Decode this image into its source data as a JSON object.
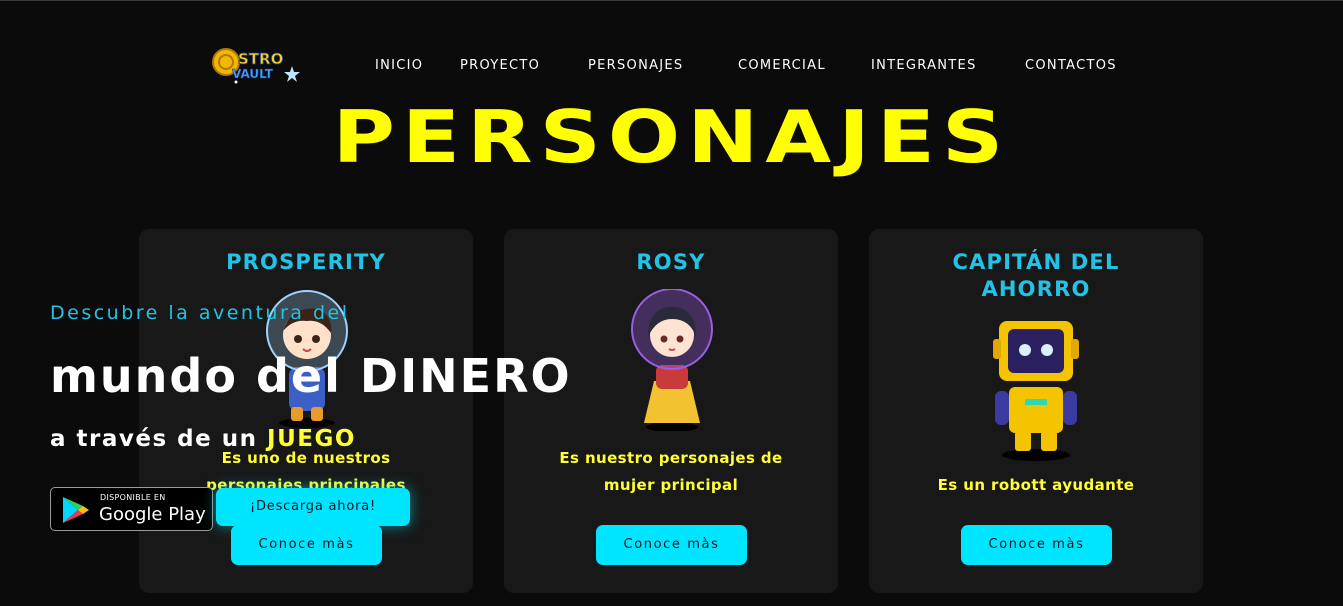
{
  "logo": {
    "text_top": "STRO",
    "text_bottom": "VAULT"
  },
  "nav": [
    "INICIO",
    "PROYECTO",
    "PERSONAJES",
    "COMERCIAL",
    "INTEGRANTES",
    "CONTACTOS"
  ],
  "page_title": "PERSONAJES",
  "cards": [
    {
      "title": "PROSPERITY",
      "desc": "Es uno de nuestros personajes principales",
      "button": "Conoce màs"
    },
    {
      "title": "ROSY",
      "desc": "Es nuestro personajes de mujer principal",
      "button": "Conoce màs"
    },
    {
      "title_line1": "CAPITÁN DEL",
      "title_line2": "AHORRO",
      "desc": "Es un robott ayudante",
      "button": "Conoce màs"
    }
  ],
  "hero": {
    "subtitle": "Descubre la aventura del",
    "headline": "mundo del DINERO",
    "line_prefix": "a través de un",
    "line_highlight": "JUEGO"
  },
  "google_play": {
    "small": "DISPONIBLE EN",
    "big": "Google Play"
  },
  "download_button": "¡Descarga ahora!",
  "colors": {
    "accent": "#ffff00",
    "cyan": "#22c3e6",
    "button": "#00e5ff",
    "background": "#0b0b0b",
    "card": "#181818"
  }
}
